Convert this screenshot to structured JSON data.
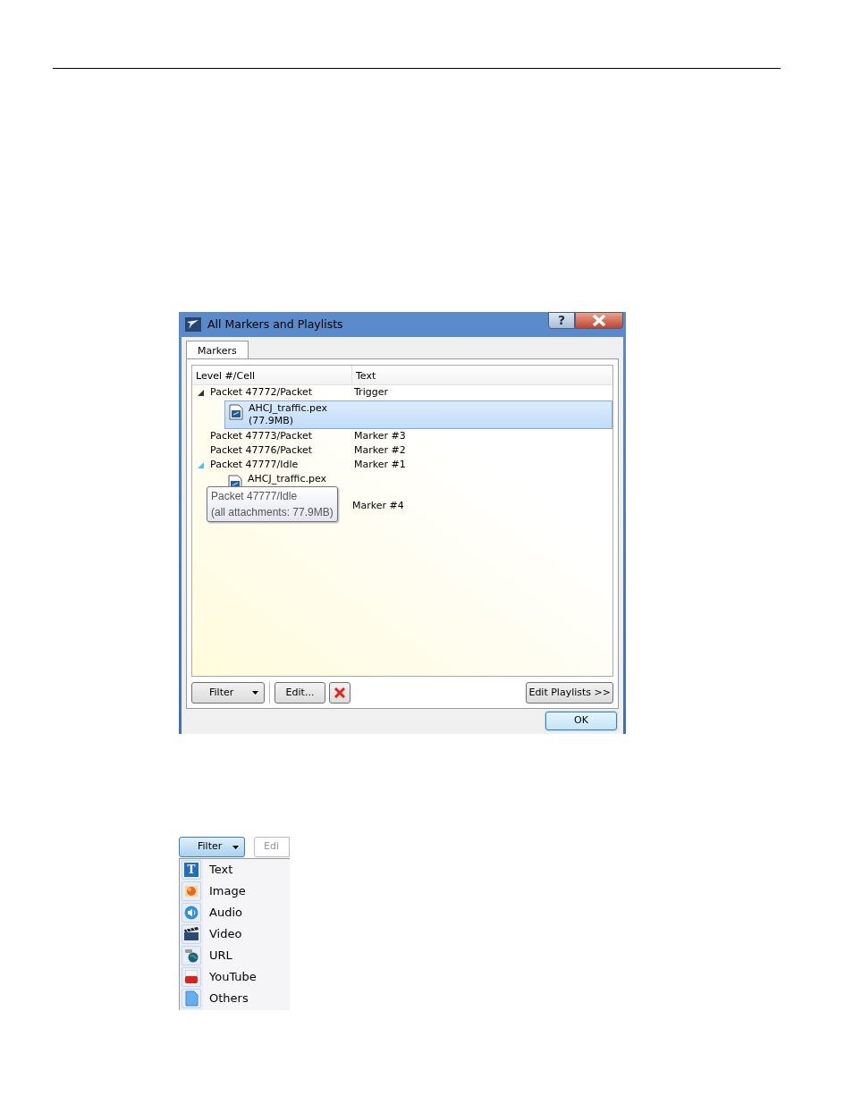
{
  "dialog": {
    "title": "All Markers and Playlists",
    "help_glyph": "?",
    "tabs": [
      {
        "label": "Markers",
        "selected": true
      }
    ],
    "tree": {
      "columns": [
        "Level #/Cell",
        "Text"
      ],
      "rows": [
        {
          "kind": "node",
          "label": "Packet 47772/Packet",
          "text": "Trigger",
          "expanded": true,
          "hover": false,
          "selected": false,
          "children": [
            {
              "kind": "file",
              "label": "AHCJ_traffic.pex",
              "sublabel": "(77.9MB)",
              "selected": true
            }
          ]
        },
        {
          "kind": "node",
          "label": "Packet 47773/Packet",
          "text": "Marker #3",
          "selected": false
        },
        {
          "kind": "node",
          "label": "Packet 47776/Packet",
          "text": "Marker #2",
          "selected": false
        },
        {
          "kind": "node",
          "label": "Packet 47777/Idle",
          "text": "Marker #1",
          "expanded": true,
          "hover": true,
          "selected": false,
          "children": [
            {
              "kind": "file",
              "label": "AHCJ_traffic.pex",
              "selected": false
            }
          ]
        },
        {
          "kind": "node",
          "text": "Marker #4",
          "selected": false
        }
      ],
      "tooltip": [
        "Packet 47777/Idle",
        "(all attachments: 77.9MB)"
      ]
    },
    "toolbar": {
      "filter": "Filter",
      "edit": "Edit...",
      "edit_playlists": "Edit Playlists >>"
    },
    "ok": "OK"
  },
  "filter_menu": {
    "button": "Filter",
    "pressed": true,
    "cut_button": "Edi",
    "items": [
      {
        "kind": "text",
        "label": "Text",
        "glyph": "T"
      },
      {
        "kind": "image",
        "label": "Image"
      },
      {
        "kind": "audio",
        "label": "Audio"
      },
      {
        "kind": "video",
        "label": "Video"
      },
      {
        "kind": "url",
        "label": "URL"
      },
      {
        "kind": "youtube",
        "label": "YouTube"
      },
      {
        "kind": "others",
        "label": "Others"
      }
    ]
  }
}
